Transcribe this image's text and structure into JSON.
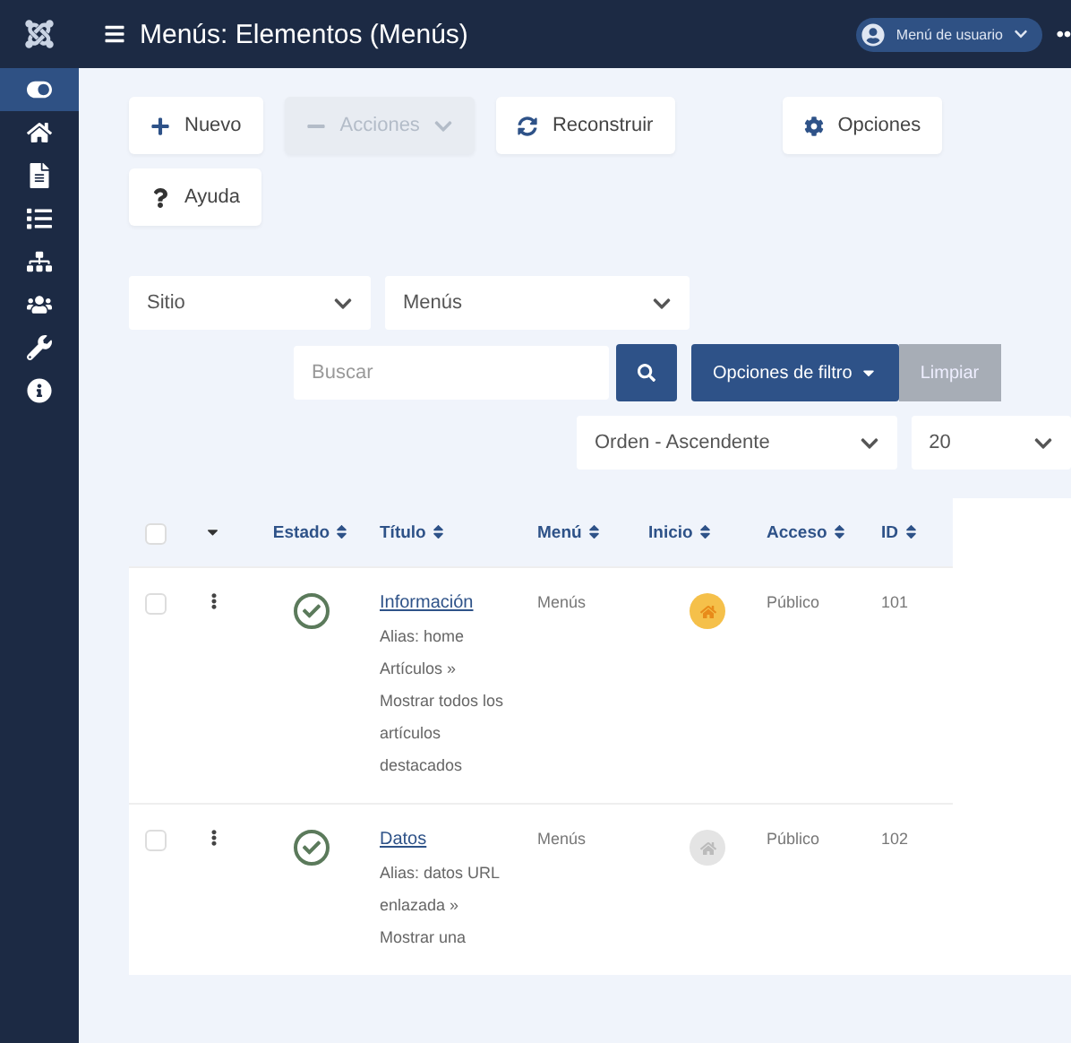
{
  "header": {
    "title": "Menús: Elementos (Menús)",
    "user_menu": "Menú de usuario"
  },
  "sidebar": {
    "items": [
      {
        "kind": "toggle",
        "selected": true
      },
      {
        "kind": "home",
        "selected": false
      },
      {
        "kind": "file",
        "selected": false
      },
      {
        "kind": "list",
        "selected": false
      },
      {
        "kind": "sitemap",
        "selected": false
      },
      {
        "kind": "users",
        "selected": false
      },
      {
        "kind": "wrench",
        "selected": false
      },
      {
        "kind": "info",
        "selected": false
      }
    ]
  },
  "toolbar": {
    "buttons": [
      {
        "kind": "new",
        "label": "Nuevo",
        "disabled": false
      },
      {
        "kind": "actions",
        "label": "Acciones",
        "disabled": true
      },
      {
        "kind": "rebuild",
        "label": "Reconstruir",
        "disabled": false
      },
      {
        "kind": "options",
        "label": "Opciones",
        "disabled": false
      },
      {
        "kind": "help",
        "label": "Ayuda",
        "disabled": false
      }
    ]
  },
  "filters": {
    "site": "Sitio",
    "menu": "Menús",
    "search_placeholder": "Buscar",
    "filter_options": "Opciones de filtro",
    "clear": "Limpiar",
    "ordering": "Orden - Ascendente",
    "limit": "20"
  },
  "table": {
    "select_all": false,
    "columns": [
      "Estado",
      "Título",
      "Menú",
      "Inicio",
      "Acceso",
      "ID"
    ],
    "rows": [
      {
        "checked": false,
        "published": true,
        "title": "Información",
        "details": "Alias: home Artículos » Mostrar todos los artículos destacados",
        "menu": "Menús",
        "home": true,
        "access": "Público",
        "id": "101"
      },
      {
        "checked": false,
        "published": true,
        "title": "Datos",
        "details": "Alias: datos URL enlazada » Mostrar una",
        "menu": "Menús",
        "home": false,
        "access": "Público",
        "id": "102"
      }
    ]
  }
}
